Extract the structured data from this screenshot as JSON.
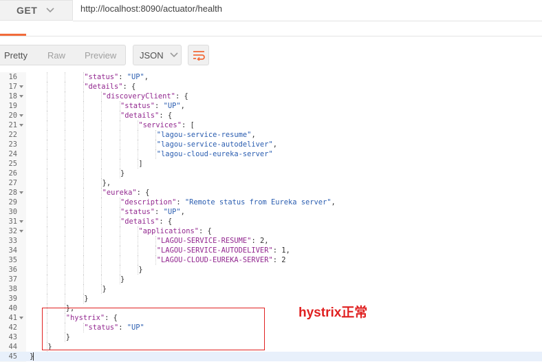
{
  "request": {
    "method": "GET",
    "url": "http://localhost:8090/actuator/health"
  },
  "toolbar": {
    "views": [
      "Pretty",
      "Raw",
      "Preview"
    ],
    "active_view": "Pretty",
    "format": "JSON",
    "wrap_icon": "wrap-lines-icon"
  },
  "colors": {
    "accent": "#f26b3a",
    "json_key": "#92278f",
    "json_string": "#2a5db0",
    "annotation": "#e02020"
  },
  "code": {
    "lines": [
      {
        "n": "16",
        "fold": false,
        "indent": 3,
        "parts": [
          [
            "k",
            "\"status\""
          ],
          [
            "n",
            ": "
          ],
          [
            "s",
            "\"UP\""
          ],
          [
            "n",
            ","
          ]
        ]
      },
      {
        "n": "17",
        "fold": true,
        "indent": 3,
        "parts": [
          [
            "k",
            "\"details\""
          ],
          [
            "n",
            ": {"
          ]
        ]
      },
      {
        "n": "18",
        "fold": true,
        "indent": 4,
        "parts": [
          [
            "k",
            "\"discoveryClient\""
          ],
          [
            "n",
            ": {"
          ]
        ]
      },
      {
        "n": "19",
        "fold": false,
        "indent": 5,
        "parts": [
          [
            "k",
            "\"status\""
          ],
          [
            "n",
            ": "
          ],
          [
            "s",
            "\"UP\""
          ],
          [
            "n",
            ","
          ]
        ]
      },
      {
        "n": "20",
        "fold": true,
        "indent": 5,
        "parts": [
          [
            "k",
            "\"details\""
          ],
          [
            "n",
            ": {"
          ]
        ]
      },
      {
        "n": "21",
        "fold": true,
        "indent": 6,
        "parts": [
          [
            "k",
            "\"services\""
          ],
          [
            "n",
            ": ["
          ]
        ]
      },
      {
        "n": "22",
        "fold": false,
        "indent": 7,
        "parts": [
          [
            "s",
            "\"lagou-service-resume\""
          ],
          [
            "n",
            ","
          ]
        ]
      },
      {
        "n": "23",
        "fold": false,
        "indent": 7,
        "parts": [
          [
            "s",
            "\"lagou-service-autodeliver\""
          ],
          [
            "n",
            ","
          ]
        ]
      },
      {
        "n": "24",
        "fold": false,
        "indent": 7,
        "parts": [
          [
            "s",
            "\"lagou-cloud-eureka-server\""
          ]
        ]
      },
      {
        "n": "25",
        "fold": false,
        "indent": 6,
        "parts": [
          [
            "n",
            "]"
          ]
        ]
      },
      {
        "n": "26",
        "fold": false,
        "indent": 5,
        "parts": [
          [
            "n",
            "}"
          ]
        ]
      },
      {
        "n": "27",
        "fold": false,
        "indent": 4,
        "parts": [
          [
            "n",
            "},"
          ]
        ]
      },
      {
        "n": "28",
        "fold": true,
        "indent": 4,
        "parts": [
          [
            "k",
            "\"eureka\""
          ],
          [
            "n",
            ": {"
          ]
        ]
      },
      {
        "n": "29",
        "fold": false,
        "indent": 5,
        "parts": [
          [
            "k",
            "\"description\""
          ],
          [
            "n",
            ": "
          ],
          [
            "s",
            "\"Remote status from Eureka server\""
          ],
          [
            "n",
            ","
          ]
        ]
      },
      {
        "n": "30",
        "fold": false,
        "indent": 5,
        "parts": [
          [
            "k",
            "\"status\""
          ],
          [
            "n",
            ": "
          ],
          [
            "s",
            "\"UP\""
          ],
          [
            "n",
            ","
          ]
        ]
      },
      {
        "n": "31",
        "fold": true,
        "indent": 5,
        "parts": [
          [
            "k",
            "\"details\""
          ],
          [
            "n",
            ": {"
          ]
        ]
      },
      {
        "n": "32",
        "fold": true,
        "indent": 6,
        "parts": [
          [
            "k",
            "\"applications\""
          ],
          [
            "n",
            ": {"
          ]
        ]
      },
      {
        "n": "33",
        "fold": false,
        "indent": 7,
        "parts": [
          [
            "k",
            "\"LAGOU-SERVICE-RESUME\""
          ],
          [
            "n",
            ": 2,"
          ]
        ]
      },
      {
        "n": "34",
        "fold": false,
        "indent": 7,
        "parts": [
          [
            "k",
            "\"LAGOU-SERVICE-AUTODELIVER\""
          ],
          [
            "n",
            ": 1,"
          ]
        ]
      },
      {
        "n": "35",
        "fold": false,
        "indent": 7,
        "parts": [
          [
            "k",
            "\"LAGOU-CLOUD-EUREKA-SERVER\""
          ],
          [
            "n",
            ": 2"
          ]
        ]
      },
      {
        "n": "36",
        "fold": false,
        "indent": 6,
        "parts": [
          [
            "n",
            "}"
          ]
        ]
      },
      {
        "n": "37",
        "fold": false,
        "indent": 5,
        "parts": [
          [
            "n",
            "}"
          ]
        ]
      },
      {
        "n": "38",
        "fold": false,
        "indent": 4,
        "parts": [
          [
            "n",
            "}"
          ]
        ]
      },
      {
        "n": "39",
        "fold": false,
        "indent": 3,
        "parts": [
          [
            "n",
            "}"
          ]
        ]
      },
      {
        "n": "40",
        "fold": false,
        "indent": 2,
        "parts": [
          [
            "n",
            "},"
          ]
        ]
      },
      {
        "n": "41",
        "fold": true,
        "indent": 2,
        "parts": [
          [
            "k",
            "\"hystrix\""
          ],
          [
            "n",
            ": {"
          ]
        ]
      },
      {
        "n": "42",
        "fold": false,
        "indent": 3,
        "parts": [
          [
            "k",
            "\"status\""
          ],
          [
            "n",
            ": "
          ],
          [
            "s",
            "\"UP\""
          ]
        ]
      },
      {
        "n": "43",
        "fold": false,
        "indent": 2,
        "parts": [
          [
            "n",
            "}"
          ]
        ]
      },
      {
        "n": "44",
        "fold": false,
        "indent": 1,
        "parts": [
          [
            "n",
            "}"
          ]
        ]
      },
      {
        "n": "45",
        "fold": false,
        "indent": 0,
        "parts": [
          [
            "n",
            "}"
          ]
        ]
      }
    ],
    "cursor_line": "45"
  },
  "annotation": {
    "note": "hystrix正常"
  }
}
